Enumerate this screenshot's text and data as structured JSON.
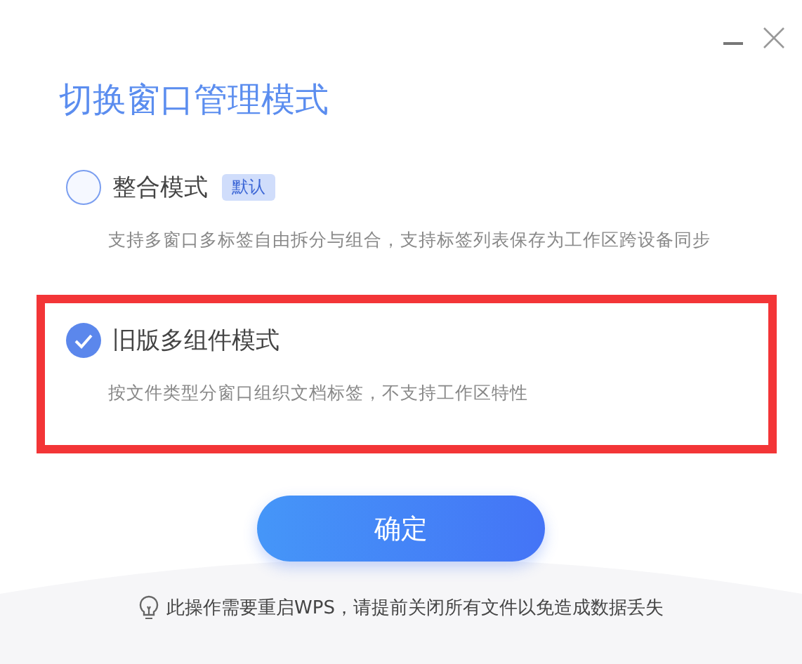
{
  "title": "切换窗口管理模式",
  "options": [
    {
      "label": "整合模式",
      "badge": "默认",
      "description": "支持多窗口多标签自由拆分与组合，支持标签列表保存为工作区跨设备同步",
      "selected": false,
      "highlighted": false
    },
    {
      "label": "旧版多组件模式",
      "description": "按文件类型分窗口组织文档标签，不支持工作区特性",
      "selected": true,
      "highlighted": true
    }
  ],
  "confirm_button": "确定",
  "hint": "此操作需要重启WPS，请提前关闭所有文件以免造成数据丢失"
}
